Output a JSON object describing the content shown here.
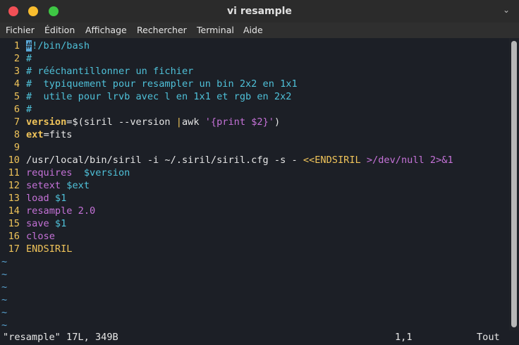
{
  "window": {
    "title": "vi resample"
  },
  "menu": [
    "Fichier",
    "Édition",
    "Affichage",
    "Rechercher",
    "Terminal",
    "Aide"
  ],
  "lines": [
    {
      "n": "1",
      "segments": [
        {
          "t": "#",
          "c": "cursor"
        },
        {
          "t": "!/bin/bash",
          "c": "c-comment"
        }
      ]
    },
    {
      "n": "2",
      "segments": [
        {
          "t": "#",
          "c": "c-comment"
        }
      ]
    },
    {
      "n": "3",
      "segments": [
        {
          "t": "# rééchantillonner un fichier",
          "c": "c-comment"
        }
      ]
    },
    {
      "n": "4",
      "segments": [
        {
          "t": "#  typiquement pour resampler un bin 2x2 en 1x1",
          "c": "c-comment"
        }
      ]
    },
    {
      "n": "5",
      "segments": [
        {
          "t": "#  utile pour lrvb avec l en 1x1 et rgb en 2x2",
          "c": "c-comment"
        }
      ]
    },
    {
      "n": "6",
      "segments": [
        {
          "t": "#",
          "c": "c-comment"
        }
      ]
    },
    {
      "n": "7",
      "segments": [
        {
          "t": "version",
          "c": "c-var"
        },
        {
          "t": "=$(siril --version ",
          "c": "c-plain"
        },
        {
          "t": "|",
          "c": "c-op"
        },
        {
          "t": "awk ",
          "c": "c-plain"
        },
        {
          "t": "'{print $2}'",
          "c": "c-str"
        },
        {
          "t": ")",
          "c": "c-plain"
        }
      ]
    },
    {
      "n": "8",
      "segments": [
        {
          "t": "ext",
          "c": "c-var"
        },
        {
          "t": "=fits",
          "c": "c-plain"
        }
      ]
    },
    {
      "n": "9",
      "segments": []
    },
    {
      "n": "10",
      "segments": [
        {
          "t": "/usr/local/bin/siril -i ~/.siril/siril.cfg -s - ",
          "c": "c-plain"
        },
        {
          "t": "<<ENDSIRIL ",
          "c": "c-heredoc"
        },
        {
          "t": ">/dev/null 2>&1",
          "c": "c-str"
        }
      ]
    },
    {
      "n": "11",
      "segments": [
        {
          "t": "requires  ",
          "c": "c-cmd"
        },
        {
          "t": "$version",
          "c": "c-cyan"
        }
      ]
    },
    {
      "n": "12",
      "segments": [
        {
          "t": "setext ",
          "c": "c-cmd"
        },
        {
          "t": "$ext",
          "c": "c-cyan"
        }
      ]
    },
    {
      "n": "13",
      "segments": [
        {
          "t": "load ",
          "c": "c-cmd"
        },
        {
          "t": "$1",
          "c": "c-cyan"
        }
      ]
    },
    {
      "n": "14",
      "segments": [
        {
          "t": "resample 2.0",
          "c": "c-cmd"
        }
      ]
    },
    {
      "n": "15",
      "segments": [
        {
          "t": "save ",
          "c": "c-cmd"
        },
        {
          "t": "$1",
          "c": "c-cyan"
        }
      ]
    },
    {
      "n": "16",
      "segments": [
        {
          "t": "close",
          "c": "c-cmd"
        }
      ]
    },
    {
      "n": "17",
      "segments": [
        {
          "t": "ENDSIRIL",
          "c": "c-heredoc"
        }
      ]
    }
  ],
  "tildes": [
    "~",
    "~",
    "~",
    "~",
    "~",
    "~"
  ],
  "status": {
    "file": "\"resample\" 17L, 349B",
    "position": "1,1",
    "scroll": "Tout"
  },
  "colors": {
    "bg": "#1c1f26",
    "comment": "#4fc1d9",
    "linenum": "#f0c45a",
    "string": "#c572d8"
  }
}
